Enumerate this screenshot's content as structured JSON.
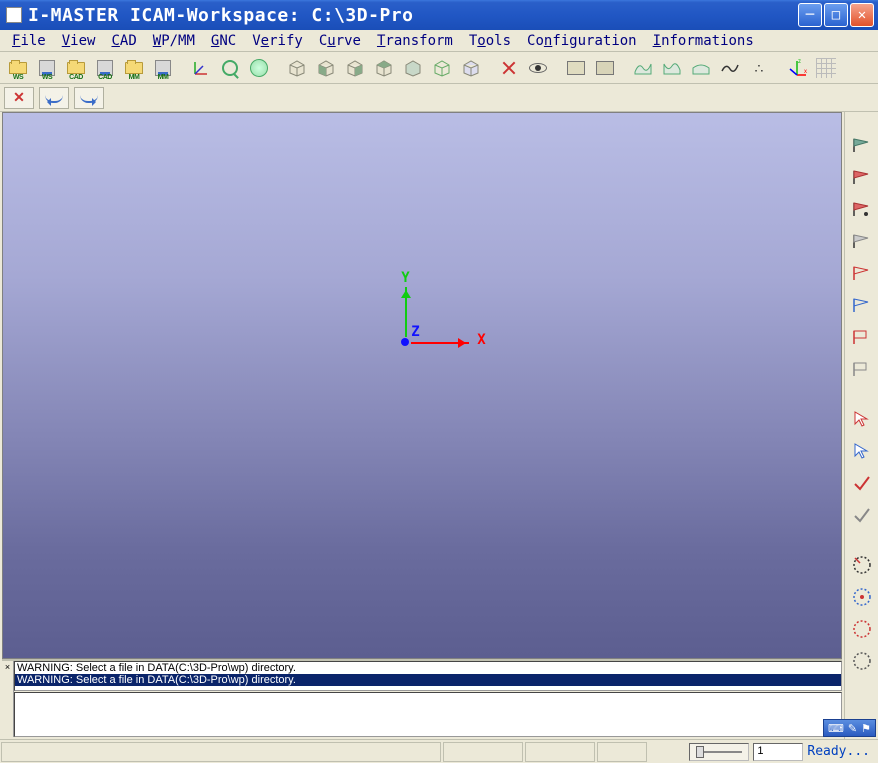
{
  "window": {
    "title": "I-MASTER ICAM-Workspace: C:\\3D-Pro"
  },
  "menu": {
    "items": [
      "File",
      "View",
      "CAD",
      "WP/MM",
      "GNC",
      "Verify",
      "Curve",
      "Transform",
      "Tools",
      "Configuration",
      "Informations"
    ]
  },
  "toolbar1": {
    "file_group": [
      {
        "name": "open-ws-button",
        "sub": "WS",
        "type": "folder"
      },
      {
        "name": "save-ws-button",
        "sub": "WS",
        "type": "disk"
      },
      {
        "name": "open-cad-button",
        "sub": "CAD",
        "type": "folder"
      },
      {
        "name": "save-cad-button",
        "sub": "CAD",
        "type": "disk"
      },
      {
        "name": "open-mm-button",
        "sub": "MM",
        "type": "folder"
      },
      {
        "name": "save-mm-button",
        "sub": "MM",
        "type": "disk"
      }
    ]
  },
  "axis": {
    "x": "X",
    "y": "Y",
    "z": "Z"
  },
  "messages": {
    "line1": "WARNING: Select a file in DATA(C:\\3D-Pro\\wp) directory.",
    "line2": "WARNING: Select a file in DATA(C:\\3D-Pro\\wp) directory."
  },
  "status": {
    "value": "1",
    "ready": "Ready..."
  }
}
